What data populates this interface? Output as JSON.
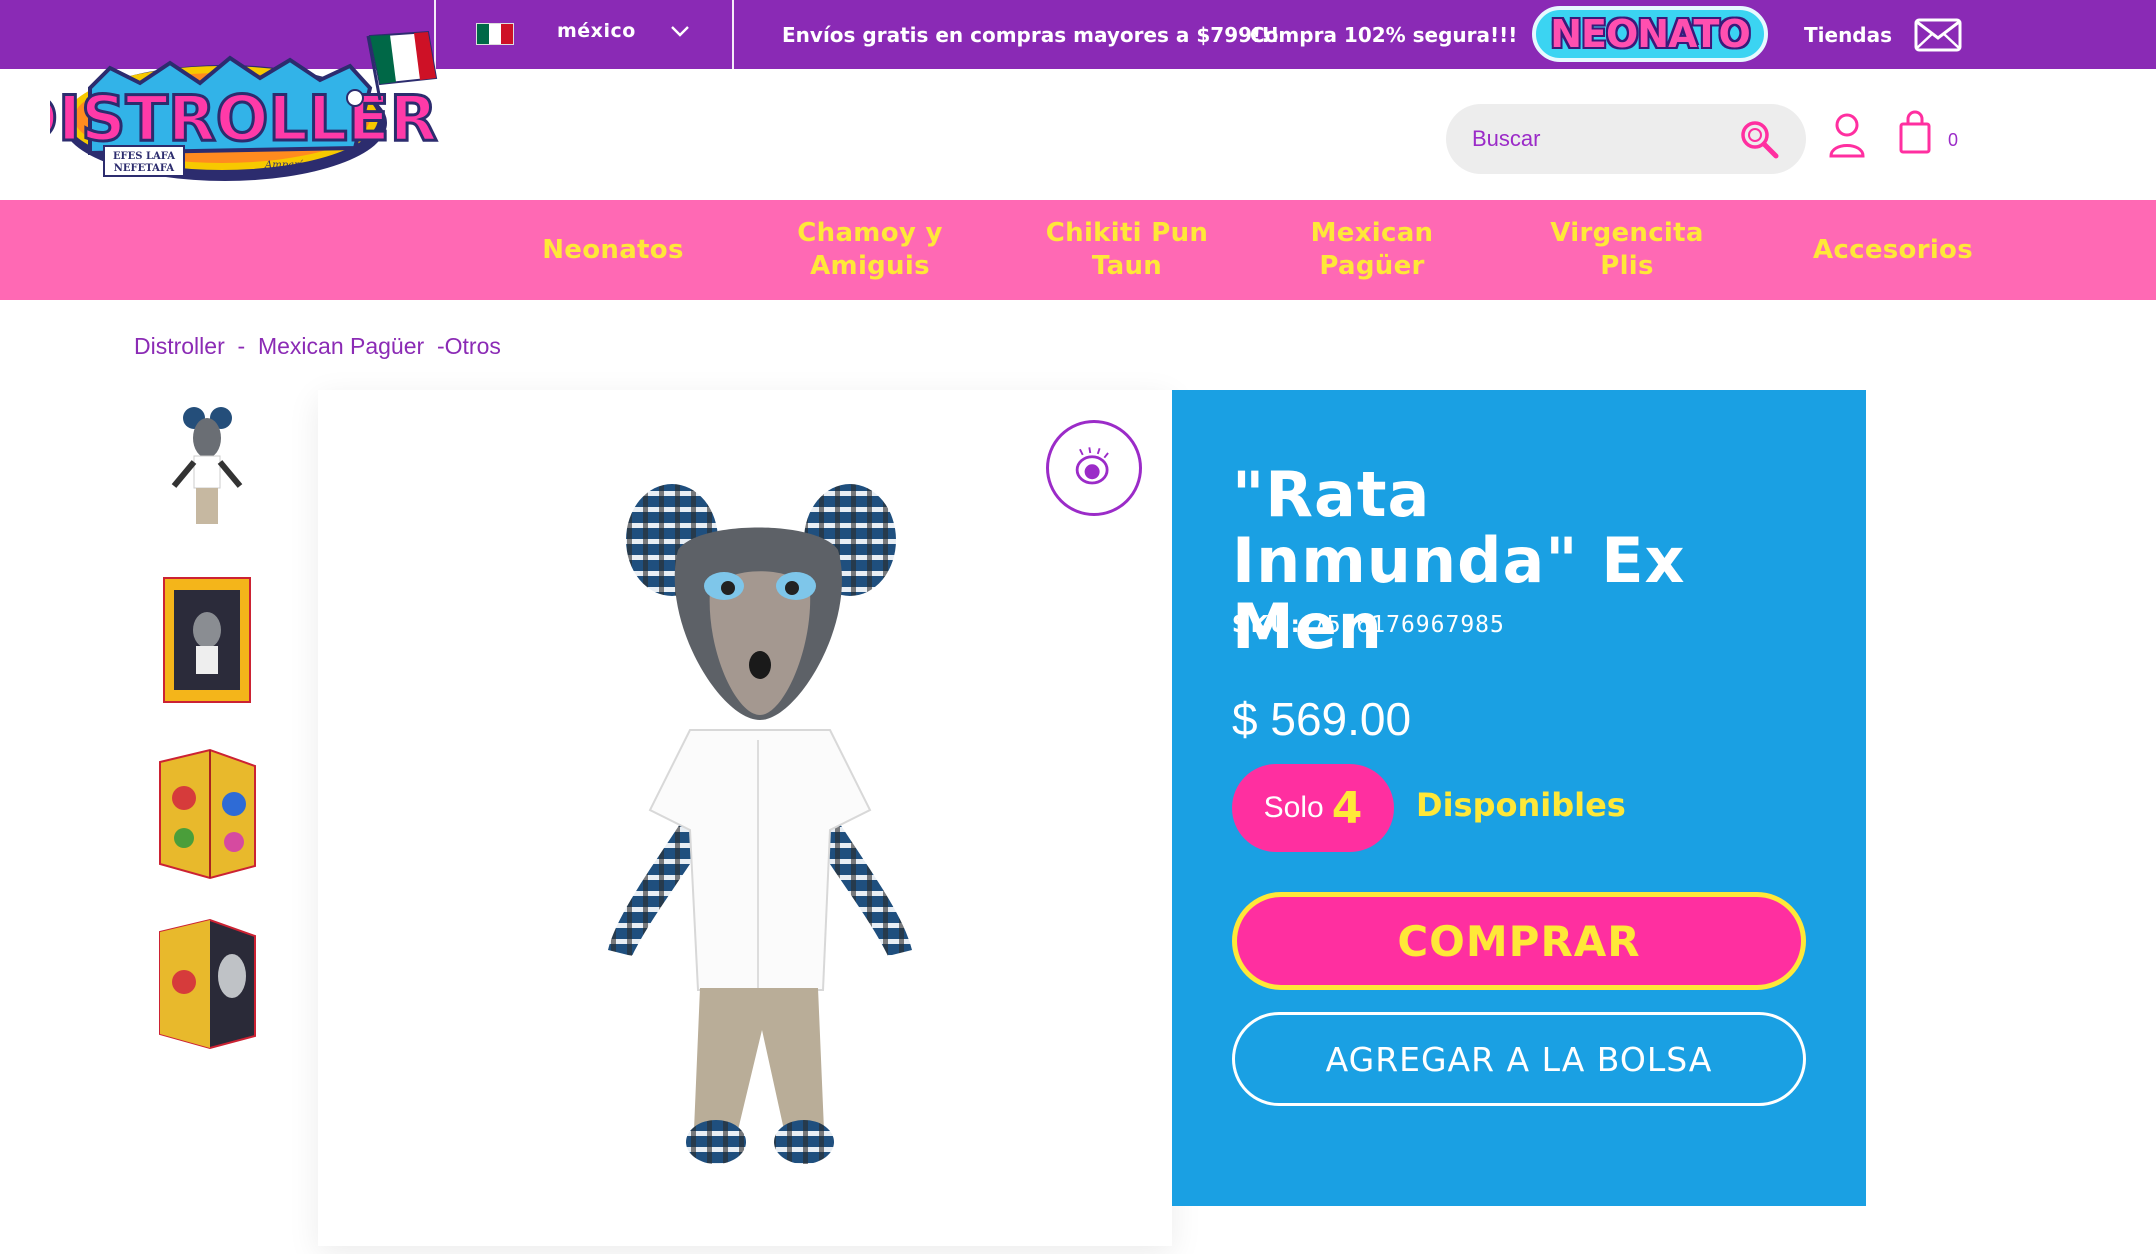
{
  "colors": {
    "purple": "#8a2ab5",
    "pink_nav": "#ff69b4",
    "yellow": "#ffe838",
    "blue_panel": "#1aa0e3",
    "hot_pink": "#ff2fa0"
  },
  "topbar": {
    "country": "méxico",
    "promo_shipping": "Envíos gratis en compras mayores a $799!!!",
    "promo_secure": "Compra 102% segura!!!",
    "neonato_logo": "NEONATO",
    "stores": "Tiendas"
  },
  "logo": {
    "brand": "DISTROLLER",
    "sub1": "EFES LAFA",
    "sub2": "NEFETAFA",
    "sub3": "Amparín"
  },
  "header": {
    "search_placeholder": "Buscar",
    "cart_count": "0"
  },
  "nav": {
    "items": [
      {
        "label": "Neonatos"
      },
      {
        "label": "Chamoy y Amiguis"
      },
      {
        "label": "Chikiti Pun Taun"
      },
      {
        "label": "Mexican Pagüer"
      },
      {
        "label": "Virgencita Plis"
      },
      {
        "label": "Accesorios"
      }
    ]
  },
  "breadcrumb": {
    "level1": "Distroller",
    "sep1": "-",
    "level2": "Mexican Pagüer",
    "sep2": "-",
    "level3": "Otros"
  },
  "product": {
    "title": "\"Rata Inmunda\" Ex Men",
    "sku_label": "SKU:",
    "sku": "7506176967985",
    "price": "$ 569.00",
    "stock_prefix": "Solo",
    "stock_count": "4",
    "stock_suffix": "Disponibles",
    "buy_label": "COMPRAR",
    "add_to_bag_label": "AGREGAR A LA BOLSA"
  }
}
